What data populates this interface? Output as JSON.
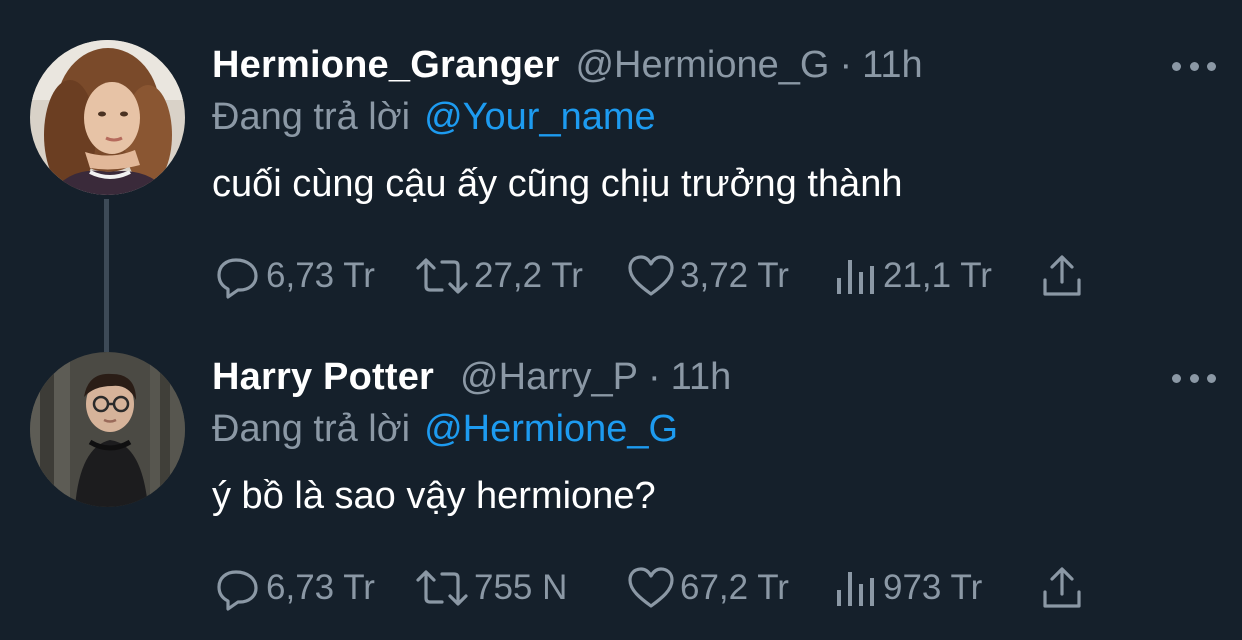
{
  "tweets": [
    {
      "display_name": "Hermione_Granger",
      "handle": "@Hermione_G",
      "separator": "·",
      "time": "11h",
      "reply_prefix": "Đang trả lời",
      "reply_to": "@Your_name",
      "text": "cuối cùng cậu ấy cũng chịu trưởng thành",
      "replies": "6,73 Tr",
      "retweets": "27,2 Tr",
      "likes": "3,72 Tr",
      "views": "21,1 Tr"
    },
    {
      "display_name": "Harry Potter",
      "handle": "@Harry_P",
      "separator": "·",
      "time": "11h",
      "reply_prefix": "Đang trả lời",
      "reply_to": "@Hermione_G",
      "text": "ý bồ là sao vậy hermione?",
      "replies": "6,73 Tr",
      "retweets": "755 N",
      "likes": "67,2 Tr",
      "views": "973 Tr"
    }
  ],
  "icons": {
    "reply": "reply-icon",
    "retweet": "retweet-icon",
    "like": "heart-icon",
    "views": "views-icon",
    "share": "share-icon",
    "more": "more-icon"
  },
  "colors": {
    "background": "#15202b",
    "muted": "#8b98a5",
    "link": "#1d9bf0",
    "thread_line": "#3d4a57"
  }
}
